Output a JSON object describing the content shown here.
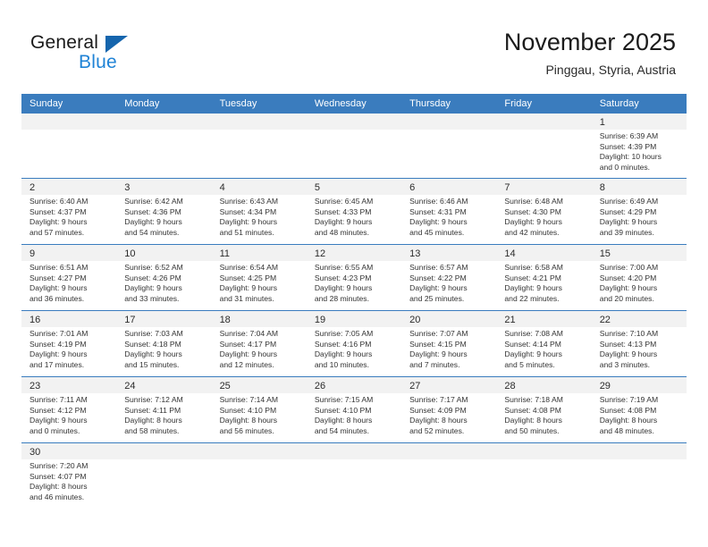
{
  "brand": {
    "name_part1": "General",
    "name_part2": "Blue",
    "triangle_color": "#1565ad",
    "blue_color": "#1f83d6"
  },
  "header": {
    "title": "November 2025",
    "subtitle": "Pinggau, Styria, Austria"
  },
  "theme": {
    "header_row_bg": "#3a7cbe",
    "daynum_band_bg": "#f2f2f2",
    "row_separator": "#3a7cbe"
  },
  "weekdays": [
    "Sunday",
    "Monday",
    "Tuesday",
    "Wednesday",
    "Thursday",
    "Friday",
    "Saturday"
  ],
  "weeks": [
    [
      {
        "day": "",
        "empty": true
      },
      {
        "day": "",
        "empty": true
      },
      {
        "day": "",
        "empty": true
      },
      {
        "day": "",
        "empty": true
      },
      {
        "day": "",
        "empty": true
      },
      {
        "day": "",
        "empty": true
      },
      {
        "day": "1",
        "sunrise": "Sunrise: 6:39 AM",
        "sunset": "Sunset: 4:39 PM",
        "daylight1": "Daylight: 10 hours",
        "daylight2": "and 0 minutes."
      }
    ],
    [
      {
        "day": "2",
        "sunrise": "Sunrise: 6:40 AM",
        "sunset": "Sunset: 4:37 PM",
        "daylight1": "Daylight: 9 hours",
        "daylight2": "and 57 minutes."
      },
      {
        "day": "3",
        "sunrise": "Sunrise: 6:42 AM",
        "sunset": "Sunset: 4:36 PM",
        "daylight1": "Daylight: 9 hours",
        "daylight2": "and 54 minutes."
      },
      {
        "day": "4",
        "sunrise": "Sunrise: 6:43 AM",
        "sunset": "Sunset: 4:34 PM",
        "daylight1": "Daylight: 9 hours",
        "daylight2": "and 51 minutes."
      },
      {
        "day": "5",
        "sunrise": "Sunrise: 6:45 AM",
        "sunset": "Sunset: 4:33 PM",
        "daylight1": "Daylight: 9 hours",
        "daylight2": "and 48 minutes."
      },
      {
        "day": "6",
        "sunrise": "Sunrise: 6:46 AM",
        "sunset": "Sunset: 4:31 PM",
        "daylight1": "Daylight: 9 hours",
        "daylight2": "and 45 minutes."
      },
      {
        "day": "7",
        "sunrise": "Sunrise: 6:48 AM",
        "sunset": "Sunset: 4:30 PM",
        "daylight1": "Daylight: 9 hours",
        "daylight2": "and 42 minutes."
      },
      {
        "day": "8",
        "sunrise": "Sunrise: 6:49 AM",
        "sunset": "Sunset: 4:29 PM",
        "daylight1": "Daylight: 9 hours",
        "daylight2": "and 39 minutes."
      }
    ],
    [
      {
        "day": "9",
        "sunrise": "Sunrise: 6:51 AM",
        "sunset": "Sunset: 4:27 PM",
        "daylight1": "Daylight: 9 hours",
        "daylight2": "and 36 minutes."
      },
      {
        "day": "10",
        "sunrise": "Sunrise: 6:52 AM",
        "sunset": "Sunset: 4:26 PM",
        "daylight1": "Daylight: 9 hours",
        "daylight2": "and 33 minutes."
      },
      {
        "day": "11",
        "sunrise": "Sunrise: 6:54 AM",
        "sunset": "Sunset: 4:25 PM",
        "daylight1": "Daylight: 9 hours",
        "daylight2": "and 31 minutes."
      },
      {
        "day": "12",
        "sunrise": "Sunrise: 6:55 AM",
        "sunset": "Sunset: 4:23 PM",
        "daylight1": "Daylight: 9 hours",
        "daylight2": "and 28 minutes."
      },
      {
        "day": "13",
        "sunrise": "Sunrise: 6:57 AM",
        "sunset": "Sunset: 4:22 PM",
        "daylight1": "Daylight: 9 hours",
        "daylight2": "and 25 minutes."
      },
      {
        "day": "14",
        "sunrise": "Sunrise: 6:58 AM",
        "sunset": "Sunset: 4:21 PM",
        "daylight1": "Daylight: 9 hours",
        "daylight2": "and 22 minutes."
      },
      {
        "day": "15",
        "sunrise": "Sunrise: 7:00 AM",
        "sunset": "Sunset: 4:20 PM",
        "daylight1": "Daylight: 9 hours",
        "daylight2": "and 20 minutes."
      }
    ],
    [
      {
        "day": "16",
        "sunrise": "Sunrise: 7:01 AM",
        "sunset": "Sunset: 4:19 PM",
        "daylight1": "Daylight: 9 hours",
        "daylight2": "and 17 minutes."
      },
      {
        "day": "17",
        "sunrise": "Sunrise: 7:03 AM",
        "sunset": "Sunset: 4:18 PM",
        "daylight1": "Daylight: 9 hours",
        "daylight2": "and 15 minutes."
      },
      {
        "day": "18",
        "sunrise": "Sunrise: 7:04 AM",
        "sunset": "Sunset: 4:17 PM",
        "daylight1": "Daylight: 9 hours",
        "daylight2": "and 12 minutes."
      },
      {
        "day": "19",
        "sunrise": "Sunrise: 7:05 AM",
        "sunset": "Sunset: 4:16 PM",
        "daylight1": "Daylight: 9 hours",
        "daylight2": "and 10 minutes."
      },
      {
        "day": "20",
        "sunrise": "Sunrise: 7:07 AM",
        "sunset": "Sunset: 4:15 PM",
        "daylight1": "Daylight: 9 hours",
        "daylight2": "and 7 minutes."
      },
      {
        "day": "21",
        "sunrise": "Sunrise: 7:08 AM",
        "sunset": "Sunset: 4:14 PM",
        "daylight1": "Daylight: 9 hours",
        "daylight2": "and 5 minutes."
      },
      {
        "day": "22",
        "sunrise": "Sunrise: 7:10 AM",
        "sunset": "Sunset: 4:13 PM",
        "daylight1": "Daylight: 9 hours",
        "daylight2": "and 3 minutes."
      }
    ],
    [
      {
        "day": "23",
        "sunrise": "Sunrise: 7:11 AM",
        "sunset": "Sunset: 4:12 PM",
        "daylight1": "Daylight: 9 hours",
        "daylight2": "and 0 minutes."
      },
      {
        "day": "24",
        "sunrise": "Sunrise: 7:12 AM",
        "sunset": "Sunset: 4:11 PM",
        "daylight1": "Daylight: 8 hours",
        "daylight2": "and 58 minutes."
      },
      {
        "day": "25",
        "sunrise": "Sunrise: 7:14 AM",
        "sunset": "Sunset: 4:10 PM",
        "daylight1": "Daylight: 8 hours",
        "daylight2": "and 56 minutes."
      },
      {
        "day": "26",
        "sunrise": "Sunrise: 7:15 AM",
        "sunset": "Sunset: 4:10 PM",
        "daylight1": "Daylight: 8 hours",
        "daylight2": "and 54 minutes."
      },
      {
        "day": "27",
        "sunrise": "Sunrise: 7:17 AM",
        "sunset": "Sunset: 4:09 PM",
        "daylight1": "Daylight: 8 hours",
        "daylight2": "and 52 minutes."
      },
      {
        "day": "28",
        "sunrise": "Sunrise: 7:18 AM",
        "sunset": "Sunset: 4:08 PM",
        "daylight1": "Daylight: 8 hours",
        "daylight2": "and 50 minutes."
      },
      {
        "day": "29",
        "sunrise": "Sunrise: 7:19 AM",
        "sunset": "Sunset: 4:08 PM",
        "daylight1": "Daylight: 8 hours",
        "daylight2": "and 48 minutes."
      }
    ],
    [
      {
        "day": "30",
        "sunrise": "Sunrise: 7:20 AM",
        "sunset": "Sunset: 4:07 PM",
        "daylight1": "Daylight: 8 hours",
        "daylight2": "and 46 minutes."
      },
      {
        "day": "",
        "empty": true
      },
      {
        "day": "",
        "empty": true
      },
      {
        "day": "",
        "empty": true
      },
      {
        "day": "",
        "empty": true
      },
      {
        "day": "",
        "empty": true
      },
      {
        "day": "",
        "empty": true
      }
    ]
  ]
}
